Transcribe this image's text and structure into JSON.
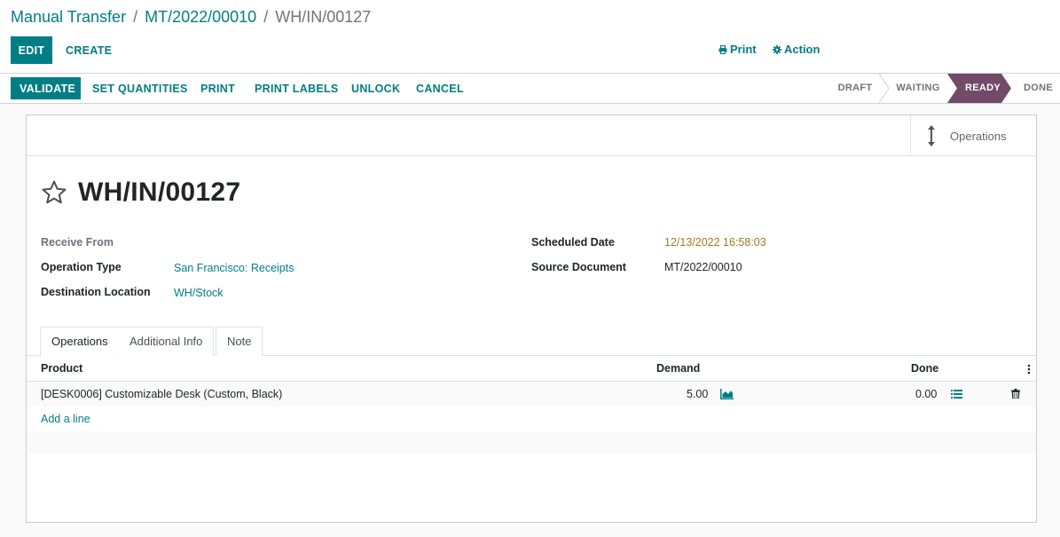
{
  "breadcrumb": {
    "parent": "Manual Transfer",
    "sep1": "/",
    "middle": "MT/2022/00010",
    "sep2": "/",
    "current": "WH/IN/00127"
  },
  "control": {
    "edit_label": "EDIT",
    "create_label": "CREATE",
    "print_label": "Print",
    "action_label": "Action"
  },
  "statusbar": {
    "buttons": [
      "VALIDATE",
      "SET QUANTITIES",
      "PRINT",
      "PRINT LABELS",
      "UNLOCK",
      "CANCEL"
    ],
    "stages": [
      "DRAFT",
      "WAITING",
      "READY",
      "DONE"
    ],
    "current_stage": "READY"
  },
  "smart_button": {
    "label": "Operations"
  },
  "record": {
    "name": "WH/IN/00127",
    "fields_left": [
      {
        "label": "Receive From",
        "value": ""
      },
      {
        "label": "Operation Type",
        "value": "San Francisco: Receipts"
      },
      {
        "label": "Destination Location",
        "value": "WH/Stock"
      }
    ],
    "fields_right": [
      {
        "label": "Scheduled Date",
        "value": "12/13/2022 16:58:03"
      },
      {
        "label": "Source Document",
        "value": "MT/2022/00010"
      }
    ]
  },
  "tabs": [
    "Operations",
    "Additional Info",
    "Note"
  ],
  "table": {
    "headers": {
      "product": "Product",
      "demand": "Demand",
      "done": "Done"
    },
    "rows": [
      {
        "product": "[DESK0006] Customizable Desk (Custom, Black)",
        "demand": "5.00",
        "done": "0.00"
      }
    ],
    "add_line": "Add a line"
  },
  "colors": {
    "primary": "#017e84",
    "current_stage": "#714b67",
    "warning_date": "#a37b1d"
  }
}
